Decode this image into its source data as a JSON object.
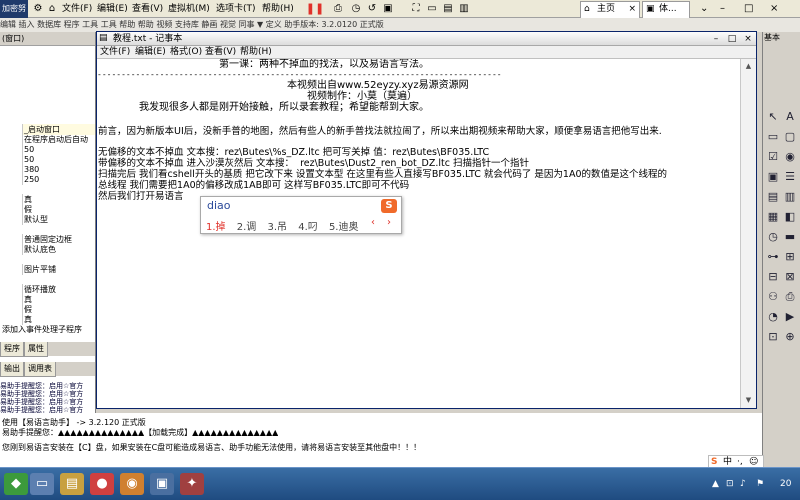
{
  "host": {
    "logo_text": "加密努",
    "menus": [
      "文件(F)",
      "编辑(E)",
      "查看(V)",
      "虚拟机(M)",
      "选项卡(T)",
      "帮助(H)"
    ],
    "tabs": [
      {
        "label": "主页"
      },
      {
        "label": "体..."
      }
    ],
    "ide_toolbar": "编辑  插入  数据库  程序  工具  工具  帮助  帮助  视频  支持库  静画  视觉  同事  ▼  定义  助手版本: 3.2.0120 正式版"
  },
  "left_panel": {
    "header": "(窗口)",
    "properties": [
      {
        "name": "",
        "value": "_启动窗口",
        "selected": true
      },
      {
        "name": "",
        "value": "在程序启动后自动"
      },
      {
        "name": "",
        "value": "50"
      },
      {
        "name": "",
        "value": "50"
      },
      {
        "name": "",
        "value": "380"
      },
      {
        "name": "",
        "value": "250"
      },
      {
        "name": "",
        "value": ""
      },
      {
        "name": "",
        "value": "真"
      },
      {
        "name": "",
        "value": "假"
      },
      {
        "name": "",
        "value": "默认型"
      },
      {
        "name": "",
        "value": ""
      },
      {
        "name": "",
        "value": "普通固定边框"
      },
      {
        "name": "",
        "value": "默认底色"
      },
      {
        "name": "",
        "value": ""
      },
      {
        "name": "",
        "value": "图片平铺"
      },
      {
        "name": "",
        "value": ""
      },
      {
        "name": "",
        "value": "循环播放"
      },
      {
        "name": "",
        "value": "真"
      },
      {
        "name": "",
        "value": "假"
      },
      {
        "name": "",
        "value": "真"
      }
    ],
    "add_event": "添加入事件处理子程序",
    "tabs_top": [
      "程序",
      "属性"
    ],
    "tabs_bottom": [
      "输出",
      "调用表"
    ],
    "log_lines": [
      "易助手提醒您：启用☆官方",
      "易助手提醒您：启用☆官方",
      "易助手提醒您：启用☆官方",
      "易助手提醒您：启用☆官方",
      "易助手提醒您：启用☆官方",
      "易助手提醒您：启用易助手"
    ]
  },
  "notepad": {
    "title": "教程.txt - 记事本",
    "menus": [
      "文件(F)",
      "编辑(E)",
      "格式(O)",
      "查看(V)",
      "帮助(H)"
    ],
    "lines": [
      "第一课：两种不掉血的找法，以及易语言写法。",
      "------------------------------------------------------------------------------------",
      "本视频出自www.52eyzy.xyz易源资源网",
      "视频制作：小莫（莫遍）",
      "我发现很多人都是刚开始接触，所以录套教程；希望能帮到大家。",
      "前言，因为新版本UI后，没新手普的地图，然后有些人的新手普找法就拉闹了，所以来出期视频来帮助大家，顺便拿易语言把他写出来.",
      "无偏移的文本不掉血 文本搜：rez\\Butes\\%s_DZ.ltc 把可写关掉 值：rez\\Butes\\BF035.LTC",
      "带偏移的文本不掉血 进入沙漠灰然后 文本搜：  rez\\Butes\\Dust2_ren_bot_DZ.ltc 扫描指针一个指针",
      "扫描完后 我们看cshell开头的基质 把它改下来 设置文本型 在这里有些人直接写BF035.LTC 就会代码了 是因为1A0的数值是这个线程的",
      "总线程 我们需要把1A0的偏移改成1AB即可 这样写BF035.LTC即可不代码",
      "然后我们打开易语言"
    ]
  },
  "ime": {
    "pinyin": "diao",
    "candidates": [
      "1.掉",
      "2.调",
      "3.吊",
      "4.叼",
      "5.迪奥"
    ],
    "logo": "S"
  },
  "output": {
    "lines": [
      "使用【易语言助手】 -> 3.2.120 正式版",
      "易助手提醒您：▲▲▲▲▲▲▲▲▲▲▲▲▲▲【加载完成】▲▲▲▲▲▲▲▲▲▲▲▲▲▲",
      "您刚到易语言安装在【C】盘，如果安装在C盘可能造成易语言、助手功能无法使用，请将易语言安装至其他盘中！！！"
    ]
  },
  "right_panel": {
    "header": "基本"
  },
  "tray": {
    "ime_lang": "中",
    "clock": "20"
  }
}
